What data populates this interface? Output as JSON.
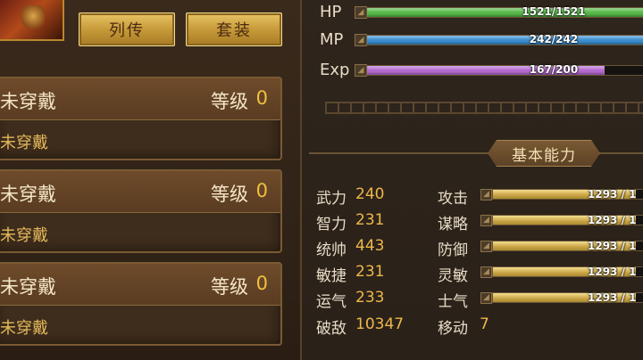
{
  "buttons": {
    "biography": "列传",
    "suit": "套装"
  },
  "equipment_slots": [
    {
      "name": "未穿戴",
      "level_label": "等级",
      "level": "0",
      "sub": "未穿戴"
    },
    {
      "name": "未穿戴",
      "level_label": "等级",
      "level": "0",
      "sub": "未穿戴"
    },
    {
      "name": "未穿戴",
      "level_label": "等级",
      "level": "0",
      "sub": "未穿戴"
    }
  ],
  "bars": [
    {
      "label": "HP",
      "text": "1521/1521",
      "fraction": 1.0,
      "color": "#58b84a"
    },
    {
      "label": "MP",
      "text": "242/242",
      "fraction": 1.0,
      "color": "#3a8fd0"
    },
    {
      "label": "Exp",
      "text": "167/200",
      "fraction": 0.835,
      "color": "#b56ad0"
    }
  ],
  "section_title": "基本能力",
  "attributes": [
    {
      "name": "武力",
      "value": "240"
    },
    {
      "name": "智力",
      "value": "231"
    },
    {
      "name": "统帅",
      "value": "443"
    },
    {
      "name": "敏捷",
      "value": "231"
    },
    {
      "name": "运气",
      "value": "233"
    },
    {
      "name": "破敌",
      "value": "10347"
    }
  ],
  "combat_stats": [
    {
      "name": "攻击",
      "text": "1293 / 1",
      "fraction": 0.9
    },
    {
      "name": "谋略",
      "text": "1293 / 1",
      "fraction": 0.9
    },
    {
      "name": "防御",
      "text": "1293 / 1",
      "fraction": 0.9
    },
    {
      "name": "灵敏",
      "text": "1293 / 1",
      "fraction": 0.9
    },
    {
      "name": "士气",
      "text": "1293 / 1",
      "fraction": 0.9
    }
  ],
  "move": {
    "name": "移动",
    "value": "7"
  }
}
